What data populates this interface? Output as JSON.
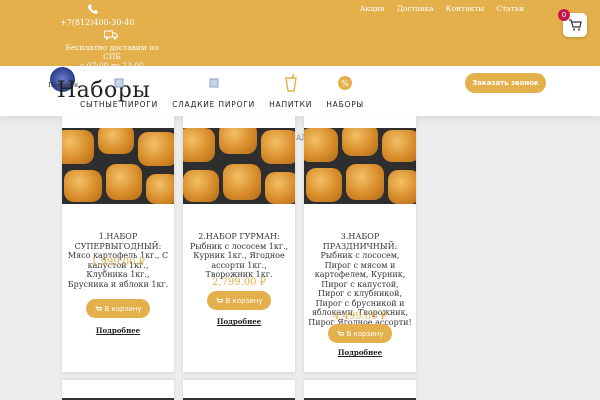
{
  "topbar": {
    "phone": "+7(812)400-30-40",
    "delivery_line1": "Бесплатно доставим по СПБ",
    "delivery_line2": "с 07:00 до 23:00",
    "links": [
      "Акции",
      "Доставка",
      "Контакты",
      "Статьи"
    ],
    "cart_count": "0",
    "accent": "#e3b04b"
  },
  "navbar": {
    "logo_text": "Пекарня",
    "page_title": "Наборы",
    "items": [
      {
        "label": "СЫТНЫЕ ПИРОГИ",
        "icon": "pie-icon"
      },
      {
        "label": "СЛАДКИЕ ПИРОГИ",
        "icon": "sweet-pie-icon"
      },
      {
        "label": "НАПИТКИ",
        "icon": "drink-icon"
      },
      {
        "label": "НАБОРЫ",
        "icon": "percent-icon"
      }
    ],
    "order_call": "Заказать звонок"
  },
  "products": [
    {
      "name": "1.НАБОР СУПЕРВЫГОДНЫЙ: Мясо картофель 1кг., С капустой 1кг., Клубника 1кг., Брусника и яблоки 1кг.",
      "price": "1,999.00 ₽",
      "cart_label": "В корзину",
      "more_label": "Подробнее"
    },
    {
      "name": "2.НАБОР ГУРМАН: Рыбник с лососем 1кг., Курник 1кг., Ягодное ассорти 1кг., Творожник 1кг.",
      "price": "2,799.00 ₽",
      "cart_label": "В корзину",
      "more_label": "Подробнее"
    },
    {
      "name": "3.НАБОР ПРАЗДНИЧНЫЙ: Рыбник с лососем, Пирог с мясом и картофелем, Курник, Пирог с капустой, Пирог с клубникой, Пирог с брусникой и яблоками, Творожник, Пирог Ягодное ассорти!",
      "price": "4,499.00 ₽",
      "cart_label": "В корзину",
      "more_label": "Подробнее"
    }
  ],
  "partial_text": "АД"
}
